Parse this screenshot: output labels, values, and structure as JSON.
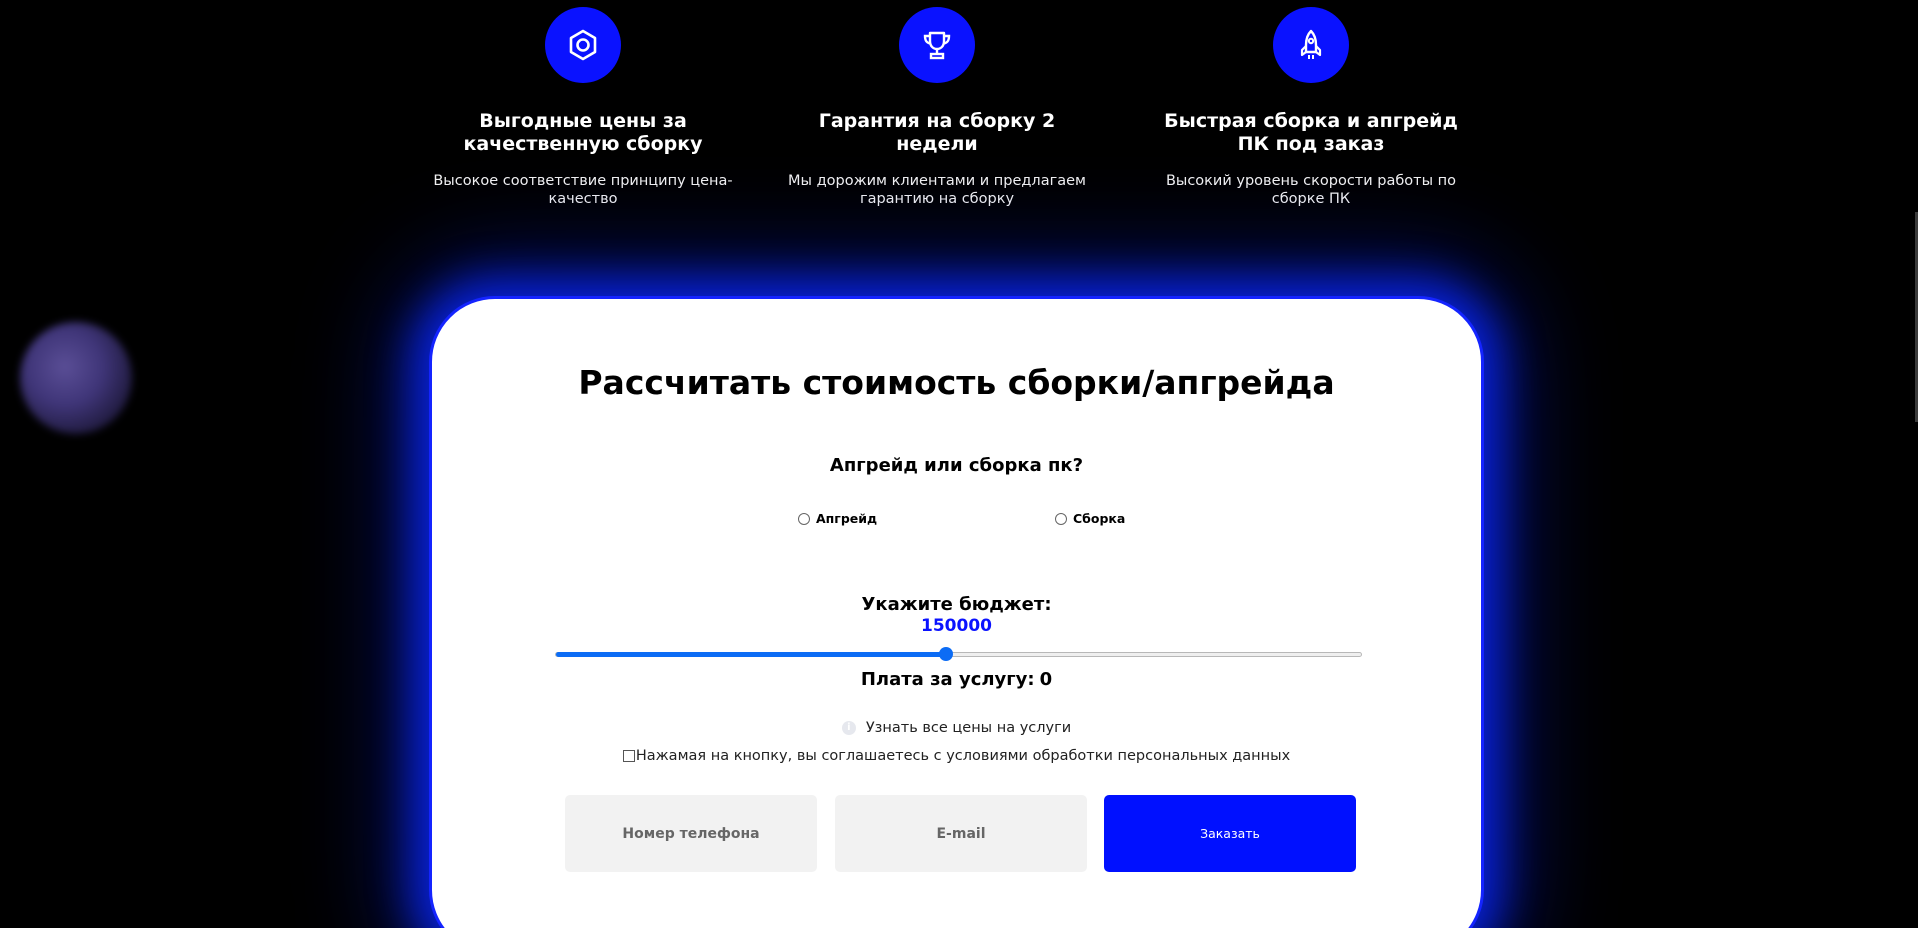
{
  "colors": {
    "accent_blue": "#0a12ff",
    "slider_blue": "#0c6cf5",
    "background": "#000000",
    "card_background": "#ffffff",
    "field_background": "#f2f2f2"
  },
  "features": [
    {
      "icon": "hexagon-nut-icon",
      "title": "Выгодные цены за качественную сборку",
      "description": "Высокое соответствие принципу цена-качество"
    },
    {
      "icon": "trophy-icon",
      "title": "Гарантия на сборку 2 недели",
      "description": "Мы дорожим клиентами и предлагаем гарантию на сборку"
    },
    {
      "icon": "rocket-icon",
      "title": "Быстрая сборка и апгрейд ПК под заказ",
      "description": "Высокий уровень скорости работы по сборке ПК"
    }
  ],
  "calculator": {
    "title": "Рассчитать стоимость сборки/апгрейда",
    "question": "Апгрейд или сборка пк?",
    "options": [
      {
        "label": "Апгрейд",
        "selected": false
      },
      {
        "label": "Сборка",
        "selected": false
      }
    ],
    "budget_label": "Укажите бюджет:",
    "budget_value": "150000",
    "budget_slider_fraction": 0.484,
    "fee_label": "Плата за услугу:",
    "fee_value": "0",
    "prices_link": "Узнать все цены на услуги",
    "consent_text": "Нажамая на кнопку, вы соглашаетесь с условиями обработки персональных данных",
    "consent_checked": false,
    "phone_placeholder": "Номер телефона",
    "email_placeholder": "E-mail",
    "order_button": "Заказать"
  }
}
